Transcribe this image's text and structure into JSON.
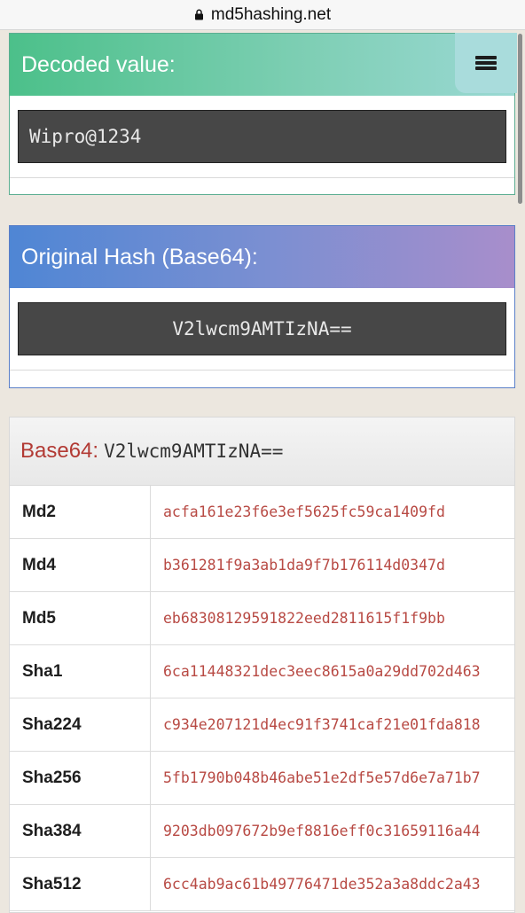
{
  "browser": {
    "host": "md5hashing.net"
  },
  "decoded_panel": {
    "title": "Decoded value:",
    "value": "Wipro@1234"
  },
  "original_panel": {
    "title": "Original Hash (Base64):",
    "value": "V2lwcm9AMTIzNA=="
  },
  "results": {
    "label": "Base64:",
    "value": "V2lwcm9AMTIzNA==",
    "rows": [
      {
        "algo": "Md2",
        "hash": "acfa161e23f6e3ef5625fc59ca1409fd"
      },
      {
        "algo": "Md4",
        "hash": "b361281f9a3ab1da9f7b176114d0347d"
      },
      {
        "algo": "Md5",
        "hash": "eb68308129591822eed2811615f1f9bb"
      },
      {
        "algo": "Sha1",
        "hash": "6ca11448321dec3eec8615a0a29dd702d463"
      },
      {
        "algo": "Sha224",
        "hash": "c934e207121d4ec91f3741caf21e01fda818"
      },
      {
        "algo": "Sha256",
        "hash": "5fb1790b048b46abe51e2df5e57d6e7a71b7"
      },
      {
        "algo": "Sha384",
        "hash": "9203db097672b9ef8816eff0c31659116a44"
      },
      {
        "algo": "Sha512",
        "hash": "6cc4ab9ac61b49776471de352a3a8ddc2a43"
      }
    ]
  },
  "icons": {
    "lock": "lock-icon",
    "menu": "hamburger-menu-icon"
  }
}
